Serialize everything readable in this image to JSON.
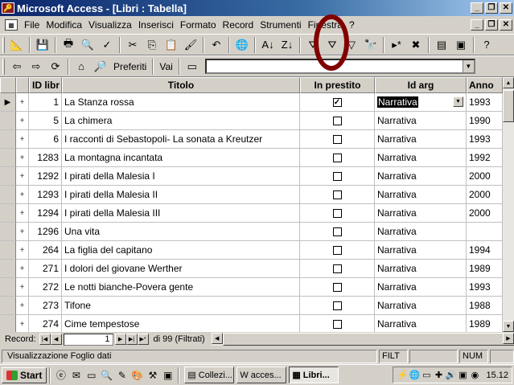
{
  "window": {
    "title": "Microsoft Access - [Libri : Tabella]"
  },
  "menu": [
    "File",
    "Modifica",
    "Visualizza",
    "Inserisci",
    "Formato",
    "Record",
    "Strumenti",
    "Finestra",
    "?"
  ],
  "web_toolbar": {
    "favorites_label": "Preferiti",
    "go_label": "Vai",
    "address_value": ""
  },
  "columns": [
    "ID libr",
    "Titolo",
    "In prestito",
    "Id arg",
    "Anno"
  ],
  "rows": [
    {
      "id": "1",
      "titolo": "La Stanza rossa",
      "prestito": true,
      "arg": "Narrativa",
      "anno": "1993"
    },
    {
      "id": "5",
      "titolo": "La chimera",
      "prestito": false,
      "arg": "Narrativa",
      "anno": "1990"
    },
    {
      "id": "6",
      "titolo": "I racconti di Sebastopoli- La sonata a Kreutzer",
      "prestito": false,
      "arg": "Narrativa",
      "anno": "1993"
    },
    {
      "id": "1283",
      "titolo": "La montagna incantata",
      "prestito": false,
      "arg": "Narrativa",
      "anno": "1992"
    },
    {
      "id": "1292",
      "titolo": "I pirati della Malesia I",
      "prestito": false,
      "arg": "Narrativa",
      "anno": "2000"
    },
    {
      "id": "1293",
      "titolo": "I pirati della Malesia II",
      "prestito": false,
      "arg": "Narrativa",
      "anno": "2000"
    },
    {
      "id": "1294",
      "titolo": "I pirati della Malesia III",
      "prestito": false,
      "arg": "Narrativa",
      "anno": "2000"
    },
    {
      "id": "1296",
      "titolo": "Una vita",
      "prestito": false,
      "arg": "Narrativa",
      "anno": ""
    },
    {
      "id": "264",
      "titolo": "La figlia del capitano",
      "prestito": false,
      "arg": "Narrativa",
      "anno": "1994"
    },
    {
      "id": "271",
      "titolo": "I dolori del giovane Werther",
      "prestito": false,
      "arg": "Narrativa",
      "anno": "1989"
    },
    {
      "id": "272",
      "titolo": "Le notti bianche-Povera gente",
      "prestito": false,
      "arg": "Narrativa",
      "anno": "1993"
    },
    {
      "id": "273",
      "titolo": "Tifone",
      "prestito": false,
      "arg": "Narrativa",
      "anno": "1988"
    },
    {
      "id": "274",
      "titolo": "Cime tempestose",
      "prestito": false,
      "arg": "Narrativa",
      "anno": "1989"
    },
    {
      "id": "",
      "titolo": "",
      "prestito": false,
      "arg": "",
      "anno": ""
    }
  ],
  "recnav": {
    "label": "Record:",
    "current": "1",
    "count": "di 99 (Filtrati)"
  },
  "status": {
    "text": "Visualizzazione Foglio dati",
    "filt": "FILT",
    "num": "NUM"
  },
  "taskbar": {
    "start": "Start",
    "tasks": [
      "Collezi...",
      "acces...",
      "Libri..."
    ],
    "clock": "15.12"
  }
}
